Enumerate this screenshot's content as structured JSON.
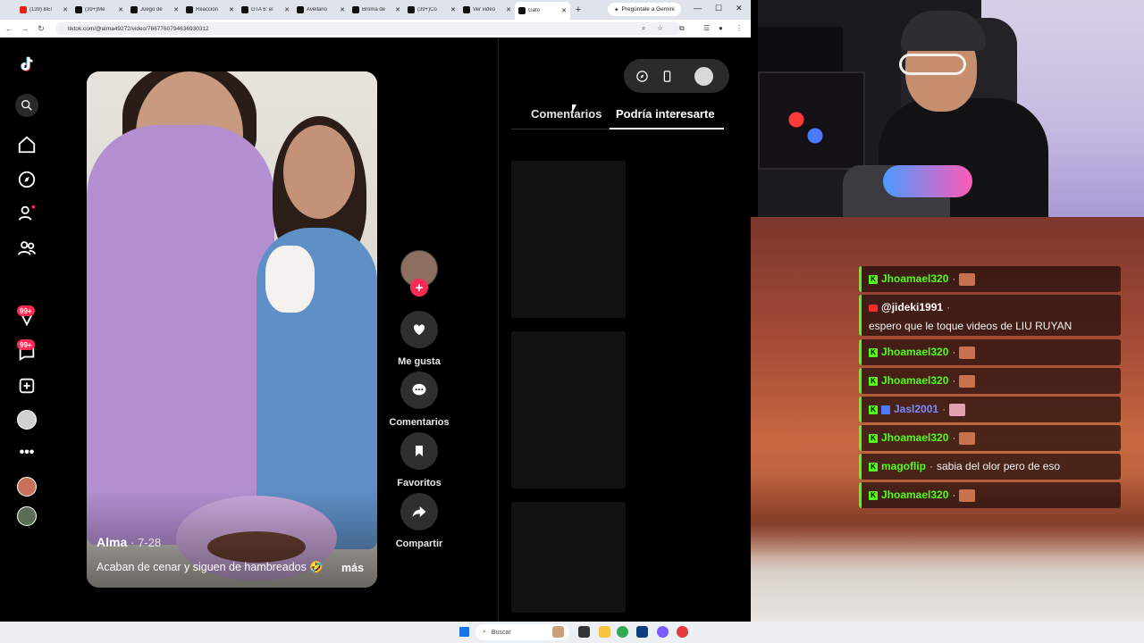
{
  "browser": {
    "tabs": [
      {
        "title": "(139) BE!",
        "favicon": "youtube"
      },
      {
        "title": "(39+)Me",
        "favicon": "tiktok"
      },
      {
        "title": "Juego de",
        "favicon": "tiktok"
      },
      {
        "title": "Reaccion",
        "favicon": "tiktok"
      },
      {
        "title": "GTA 6: el",
        "favicon": "tiktok"
      },
      {
        "title": "Avellano",
        "favicon": "tiktok"
      },
      {
        "title": "Broma de",
        "favicon": "tiktok"
      },
      {
        "title": "(39+)Co",
        "favicon": "tiktok"
      },
      {
        "title": "Ver video",
        "favicon": "tiktok"
      },
      {
        "title": "Gato",
        "favicon": "tiktok",
        "active": true
      }
    ],
    "gemini_label": "Pregúntale a Gemini",
    "url": "tiktok.com/@alma49272/video/7667760794636930312"
  },
  "sidebar": {
    "badges": [
      "99+",
      "99+"
    ]
  },
  "video": {
    "author": "Alma",
    "date": "· 7-28",
    "caption": "Acaban de cenar y siguen de hambreados 🤣",
    "more": "más"
  },
  "actions": {
    "like": "Me gusta",
    "comments": "Comentarios",
    "favorites": "Favoritos",
    "share": "Compartir"
  },
  "panel": {
    "tab_comments": "Comentarios",
    "tab_interest": "Podría interesarte"
  },
  "taskbar": {
    "search_placeholder": "Buscar"
  },
  "chat": {
    "messages": [
      {
        "user": "Jhoamael320",
        "text": "",
        "platform": "kick",
        "emote": true
      },
      {
        "user": "@jideki1991",
        "text": "espero que le toque videos de LIU RUYAN",
        "platform": "youtube"
      },
      {
        "user": "Jhoamael320",
        "text": "",
        "platform": "kick",
        "emote": true
      },
      {
        "user": "Jhoamael320",
        "text": "",
        "platform": "kick",
        "emote": true
      },
      {
        "user": "Jasl2001",
        "text": "",
        "platform": "kick",
        "emote": true
      },
      {
        "user": "Jhoamael320",
        "text": "",
        "platform": "kick",
        "emote": true
      },
      {
        "user": "magoflip",
        "text": "sabia del olor pero de eso",
        "platform": "kick"
      },
      {
        "user": "Jhoamael320",
        "text": "",
        "platform": "kick",
        "emote": true
      }
    ]
  },
  "colors": {
    "tiktok_red": "#fe2c55",
    "kick_green": "#53fc18"
  }
}
